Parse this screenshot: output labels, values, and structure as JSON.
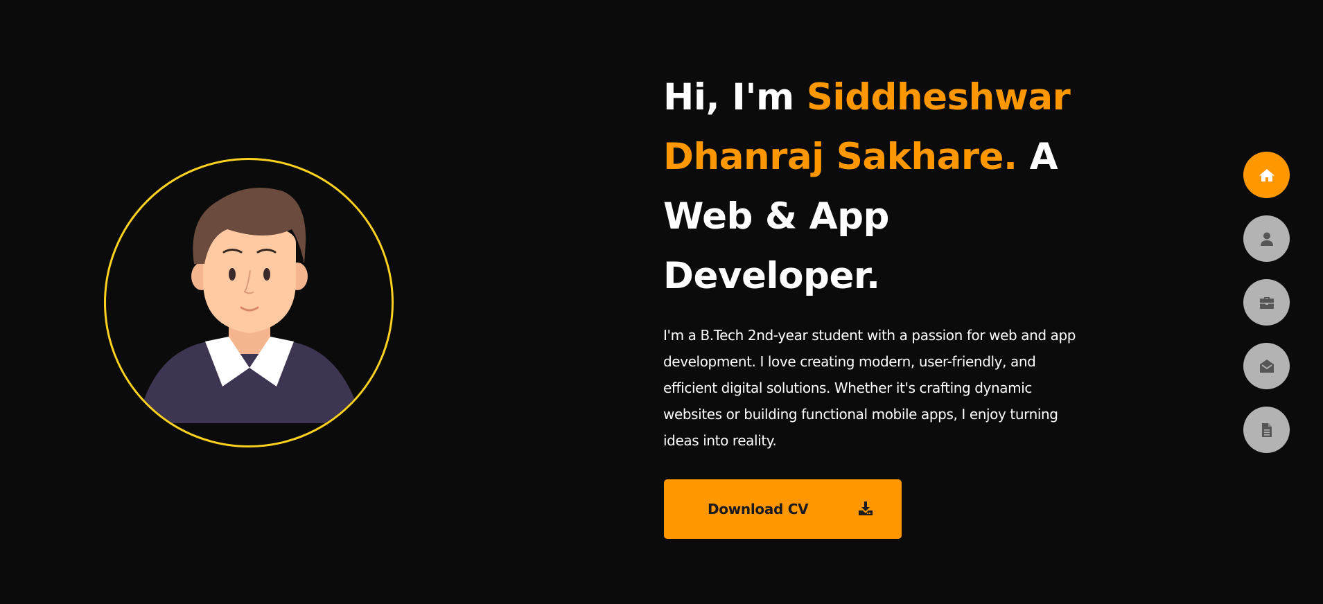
{
  "hero": {
    "title_greeting": "Hi, I'm ",
    "title_name": "Siddheshwar Dhanraj Sakhare.",
    "title_role": " A Web & App Developer.",
    "description": "I'm a B.Tech 2nd-year student with a passion for web and app development. I love creating modern, user-friendly, and efficient digital solutions. Whether it's crafting dynamic websites or building functional mobile apps, I enjoy turning ideas into reality."
  },
  "cta": {
    "download_label": "Download CV",
    "icon": "download-icon"
  },
  "side_nav": {
    "items": [
      {
        "icon": "home-icon",
        "active": true
      },
      {
        "icon": "user-icon",
        "active": false
      },
      {
        "icon": "briefcase-icon",
        "active": false
      },
      {
        "icon": "envelope-open-icon",
        "active": false
      },
      {
        "icon": "document-icon",
        "active": false
      }
    ]
  },
  "colors": {
    "background": "#0b0b0b",
    "accent": "#ff9800",
    "avatar_ring": "#ffd21f",
    "nav_inactive": "#b3b3b3",
    "text": "#ffffff"
  }
}
